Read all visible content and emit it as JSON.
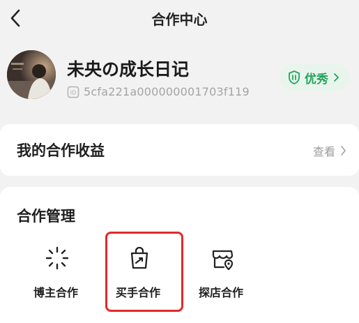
{
  "header": {
    "title": "合作中心",
    "back_icon": "chevron-left-icon"
  },
  "profile": {
    "name": "未央の成长日记",
    "id": "5cfa221a000000001703f119",
    "id_icon": "id-icon",
    "badge_label": "优秀",
    "badge_icon": "shield-icon",
    "badge_color": "#22a55a"
  },
  "earnings": {
    "label": "我的合作收益",
    "link": "查看"
  },
  "management": {
    "title": "合作管理",
    "actions": [
      {
        "label": "博主合作",
        "icon": "sparkle-icon"
      },
      {
        "label": "买手合作",
        "icon": "shopping-bag-icon"
      },
      {
        "label": "探店合作",
        "icon": "store-location-icon"
      }
    ],
    "highlight_color": "#e02a2a"
  }
}
